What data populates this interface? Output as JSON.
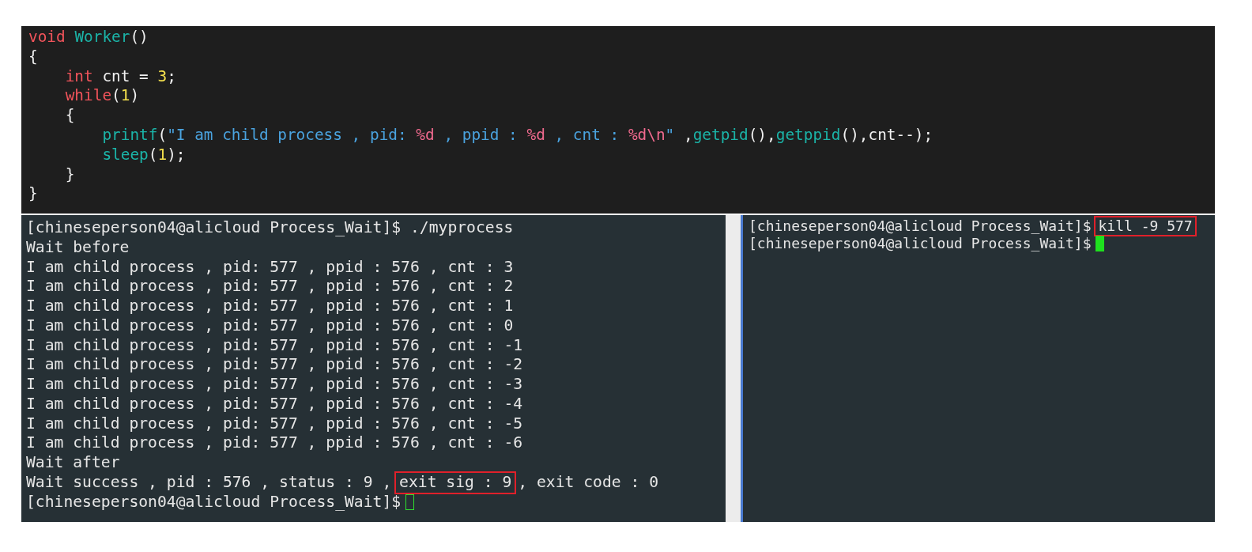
{
  "code_editor": {
    "lines": [
      {
        "tokens": [
          {
            "text": "void ",
            "kind": "keyword"
          },
          {
            "text": "Worker",
            "kind": "function"
          },
          {
            "text": "()",
            "kind": "plain"
          }
        ]
      },
      {
        "tokens": [
          {
            "text": "{",
            "kind": "plain"
          }
        ]
      },
      {
        "tokens": [
          {
            "text": "    int",
            "kind": "keyword"
          },
          {
            "text": " cnt = ",
            "kind": "plain"
          },
          {
            "text": "3",
            "kind": "number"
          },
          {
            "text": ";",
            "kind": "plain"
          }
        ]
      },
      {
        "tokens": [
          {
            "text": "    while",
            "kind": "keyword"
          },
          {
            "text": "(",
            "kind": "plain"
          },
          {
            "text": "1",
            "kind": "number"
          },
          {
            "text": ")",
            "kind": "plain"
          }
        ]
      },
      {
        "tokens": [
          {
            "text": "    {",
            "kind": "plain"
          }
        ]
      },
      {
        "tokens": [
          {
            "text": "        printf",
            "kind": "function"
          },
          {
            "text": "(",
            "kind": "plain"
          },
          {
            "text": "\"I am child process , pid: ",
            "kind": "string"
          },
          {
            "text": "%d",
            "kind": "format"
          },
          {
            "text": " , ppid : ",
            "kind": "string"
          },
          {
            "text": "%d",
            "kind": "format"
          },
          {
            "text": " , cnt : ",
            "kind": "string"
          },
          {
            "text": "%d\\n",
            "kind": "format"
          },
          {
            "text": "\"",
            "kind": "string"
          },
          {
            "text": " ,",
            "kind": "plain"
          },
          {
            "text": "getpid",
            "kind": "function"
          },
          {
            "text": "(),",
            "kind": "plain"
          },
          {
            "text": "getppid",
            "kind": "function"
          },
          {
            "text": "(),cnt--);",
            "kind": "plain"
          }
        ]
      },
      {
        "tokens": [
          {
            "text": "        sleep",
            "kind": "function"
          },
          {
            "text": "(",
            "kind": "plain"
          },
          {
            "text": "1",
            "kind": "number"
          },
          {
            "text": ");",
            "kind": "plain"
          }
        ]
      },
      {
        "tokens": [
          {
            "text": "    }",
            "kind": "plain"
          }
        ]
      },
      {
        "tokens": [
          {
            "text": "}",
            "kind": "plain"
          }
        ]
      }
    ]
  },
  "terminal_left": {
    "lines": [
      {
        "segments": [
          {
            "text": "[chineseperson04@alicloud Process_Wait]$ ./myprocess",
            "boxed": false
          }
        ]
      },
      {
        "segments": [
          {
            "text": "Wait before",
            "boxed": false
          }
        ]
      },
      {
        "segments": [
          {
            "text": "I am child process , pid: 577 , ppid : 576 , cnt : 3",
            "boxed": false
          }
        ]
      },
      {
        "segments": [
          {
            "text": "I am child process , pid: 577 , ppid : 576 , cnt : 2",
            "boxed": false
          }
        ]
      },
      {
        "segments": [
          {
            "text": "I am child process , pid: 577 , ppid : 576 , cnt : 1",
            "boxed": false
          }
        ]
      },
      {
        "segments": [
          {
            "text": "I am child process , pid: 577 , ppid : 576 , cnt : 0",
            "boxed": false
          }
        ]
      },
      {
        "segments": [
          {
            "text": "I am child process , pid: 577 , ppid : 576 , cnt : -1",
            "boxed": false
          }
        ]
      },
      {
        "segments": [
          {
            "text": "I am child process , pid: 577 , ppid : 576 , cnt : -2",
            "boxed": false
          }
        ]
      },
      {
        "segments": [
          {
            "text": "I am child process , pid: 577 , ppid : 576 , cnt : -3",
            "boxed": false
          }
        ]
      },
      {
        "segments": [
          {
            "text": "I am child process , pid: 577 , ppid : 576 , cnt : -4",
            "boxed": false
          }
        ]
      },
      {
        "segments": [
          {
            "text": "I am child process , pid: 577 , ppid : 576 , cnt : -5",
            "boxed": false
          }
        ]
      },
      {
        "segments": [
          {
            "text": "I am child process , pid: 577 , ppid : 576 , cnt : -6",
            "boxed": false
          }
        ]
      },
      {
        "segments": [
          {
            "text": "Wait after",
            "boxed": false
          }
        ]
      },
      {
        "segments": [
          {
            "text": "Wait success , pid : 576 , status : 9 ,",
            "boxed": false
          },
          {
            "text": "exit sig : 9",
            "boxed": true
          },
          {
            "text": ", exit code : 0",
            "boxed": false
          }
        ]
      },
      {
        "segments": [
          {
            "text": "[chineseperson04@alicloud Process_Wait]$",
            "boxed": false
          }
        ],
        "cursor": {
          "filled": false
        }
      }
    ]
  },
  "terminal_right": {
    "lines": [
      {
        "segments": [
          {
            "text": "[chineseperson04@alicloud Process_Wait]$",
            "boxed": false
          },
          {
            "text": "kill -9 577",
            "boxed": true
          }
        ]
      },
      {
        "segments": [
          {
            "text": "[chineseperson04@alicloud Process_Wait]$",
            "boxed": false
          }
        ],
        "cursor": {
          "filled": true
        }
      }
    ]
  }
}
